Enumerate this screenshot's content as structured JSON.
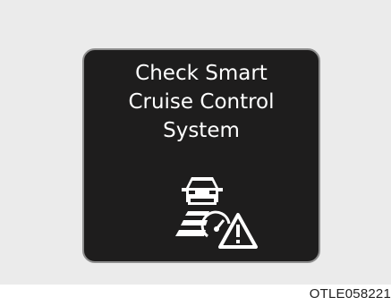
{
  "display": {
    "message_lines": [
      "Check Smart",
      "Cruise Control",
      "System"
    ],
    "icon": "smart-cruise-control-warning-icon",
    "background_color": "#1e1d1d",
    "text_color": "#ffffff"
  },
  "image_code": "OTLE058221"
}
